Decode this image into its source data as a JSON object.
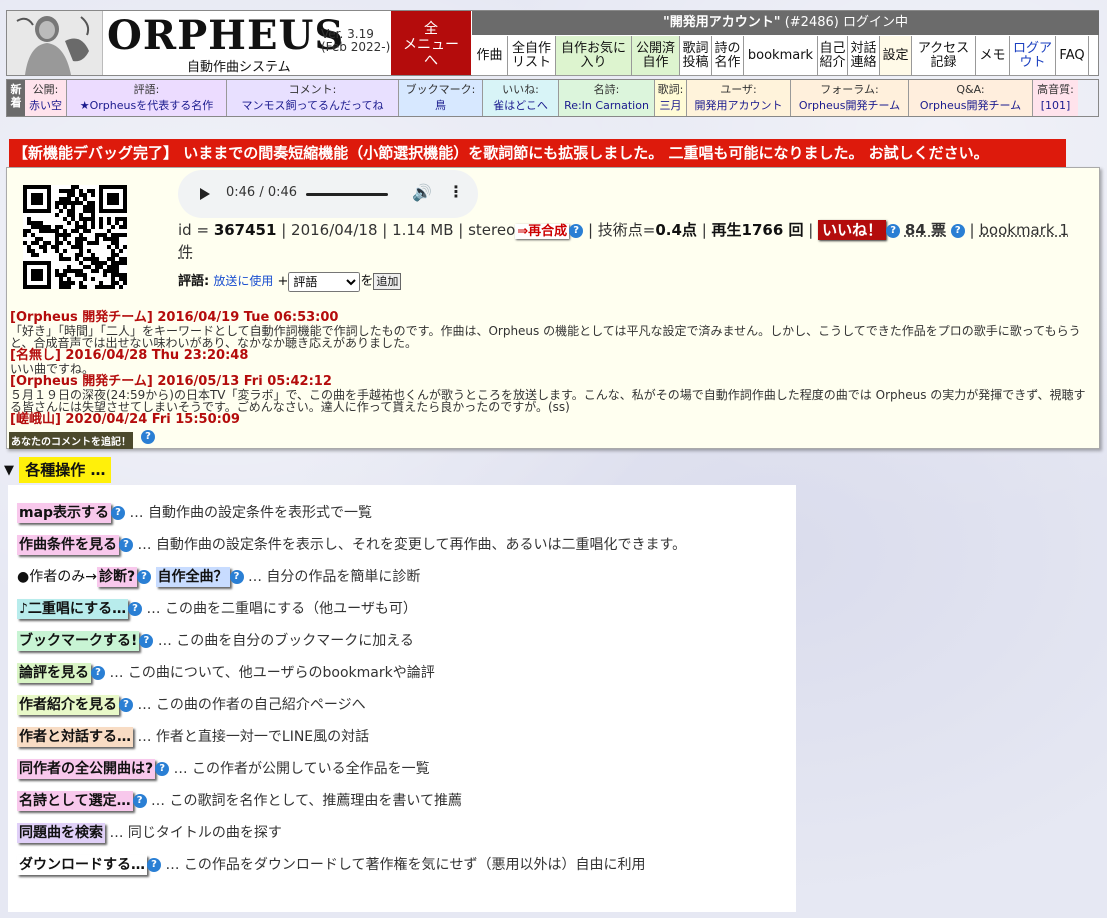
{
  "header": {
    "logo_title": "ORPHEUS",
    "logo_subtitle": "自動作曲システム",
    "version_line1": "Ver. 3.19",
    "version_line2": "(Feb 2022-)",
    "all_menu_line1": "全",
    "all_menu_line2": "メニュー",
    "all_menu_line3": "へ",
    "account_name": "\"開発用アカウント\"",
    "account_id": "(#2486)",
    "login_status": "ログイン中"
  },
  "nav": [
    {
      "label": "作曲",
      "color": "#fff"
    },
    {
      "label": "全自作リスト",
      "color": "#fff"
    },
    {
      "label": "自作お気に入り",
      "color": "#ddf4cf"
    },
    {
      "label": "公開済自作",
      "color": "#ddf4cf"
    },
    {
      "label": "歌詞投稿",
      "color": "#fff"
    },
    {
      "label": "詩の名作",
      "color": "#fff"
    },
    {
      "label": "bookmark",
      "color": "#fff"
    },
    {
      "label": "自己紹介",
      "color": "#fff"
    },
    {
      "label": "対話連絡",
      "color": "#fff"
    },
    {
      "label": "設定",
      "color": "#fffae8"
    },
    {
      "label": "アクセス記録",
      "color": "#fff"
    },
    {
      "label": "メモ",
      "color": "#fff"
    },
    {
      "label": "ログアウト",
      "color": "#fff"
    },
    {
      "label": "FAQ",
      "color": "#fff"
    }
  ],
  "subbar": {
    "new_label": "新着",
    "items": [
      {
        "label": "公開:",
        "value": "赤い空",
        "color": "#ffe3ec"
      },
      {
        "label": "評語:",
        "value": "★Orpheusを代表する名作",
        "color": "#ecdcff"
      },
      {
        "label": "コメント:",
        "value": "マンモス飼ってるんだってね",
        "color": "#e8e0ff"
      },
      {
        "label": "ブックマーク:",
        "value": "鳥",
        "color": "#d7e8ff"
      },
      {
        "label": "いいね:",
        "value": "雀はどこへ",
        "color": "#d8f4f7"
      },
      {
        "label": "名詩:",
        "value": "Re:In Carnation",
        "color": "#dcf5dc"
      },
      {
        "label": "歌詞:",
        "value": "三月",
        "color": "#fffbd6"
      },
      {
        "label": "ユーザ:",
        "value": "開発用アカウント",
        "color": "#fff3db"
      },
      {
        "label": "フォーラム:",
        "value": "Orpheus開発チーム",
        "color": "#fff0dc"
      },
      {
        "label": "Q&A:",
        "value": "Orpheus開発チーム",
        "color": "#ffeedd"
      },
      {
        "label": "高音質:",
        "value": "[101]",
        "color": "#ffe3ec"
      }
    ]
  },
  "announcement": "【新機能デバッグ完了】 いままでの間奏短縮機能（小節選択機能）を歌詞節にも拡張しました。 二重唱も可能になりました。 お試しください。",
  "player": {
    "time": "0:46 / 0:46"
  },
  "song": {
    "id_label": "id =",
    "id": "367451",
    "date": "2016/04/18",
    "size": "1.14 MB",
    "channel": "stereo",
    "resynth_label": "⇒再合成",
    "tech_label": "技術点=",
    "tech_value": "0.4点",
    "plays": "再生1766 回",
    "like_label": "いいね！",
    "votes": "84 票",
    "bookmark_text": "bookmark 1 件"
  },
  "review": {
    "label": "評語:",
    "broadcast_link": "放送に使用",
    "plus": "+",
    "select_value": "評語",
    "wo": "を",
    "add_button": "追加"
  },
  "comments": [
    {
      "head": "[Orpheus 開発チーム] 2016/04/19 Tue 06:53:00",
      "body": "「好き」「時間」「二人」をキーワードとして自動作詞機能で作詞したものです。作曲は、Orpheus の機能としては平凡な設定で済みません。しかし、こうしてできた作品をプロの歌手に歌ってもらうと、合成音声では出せない味わいがあり、なかなか聴き応えがありました。"
    },
    {
      "head": "[名無し] 2016/04/28 Thu 23:20:48",
      "body": "いい曲ですね。"
    },
    {
      "head": "[Orpheus 開発チーム] 2016/05/13 Fri 05:42:12",
      "body": "５月１９日の深夜(24:59から)の日本TV「変ラボ」で、この曲を手越祐也くんが歌うところを放送します。こんな、私がその場で自動作詞作曲した程度の曲では Orpheus の実力が発揮できず、視聴する皆さんには失望させてしまいそうです。ごめんなさい。達人に作って貰えたら良かったのですが。(ss)"
    },
    {
      "head": "[嵯峨山] 2020/04/24 Fri 15:50:09",
      "body": ""
    }
  ],
  "add_comment": "あなたのコメントを追記！",
  "ops_title": "各種操作 …",
  "ops": [
    {
      "btn": "map表示する",
      "color": "#f8c8ec",
      "desc": "… 自動作曲の設定条件を表形式で一覧"
    },
    {
      "btn": "作曲条件を見る",
      "color": "#f8c8ec",
      "desc": "… 自動作曲の設定条件を表示し、それを変更して再作曲、あるいは二重唱化できます。"
    },
    {
      "prefix": "●作者のみ→",
      "btn": "診断?",
      "color": "#f8c8ec",
      "btn2": "自作全曲？",
      "color2": "#c8dcff",
      "desc": "… 自分の作品を簡単に診断"
    },
    {
      "btn": "♪二重唱にする…",
      "color": "#b8ecec",
      "desc": "… この曲を二重唱にする（他ユーザも可）"
    },
    {
      "btn": "ブックマークする!",
      "color": "#c8f4d4",
      "desc": "… この曲を自分のブックマークに加える"
    },
    {
      "btn": "論評を見る",
      "color": "#d8f4c4",
      "desc": "… この曲について、他ユーザらのbookmarkや論評"
    },
    {
      "btn": "作者紹介を見る",
      "color": "#e8f8c8",
      "desc": "… この曲の作者の自己紹介ページへ"
    },
    {
      "btn": "作者と対話する…",
      "color": "#f8dcc4",
      "desc": "… 作者と直接一対一でLINE風の対話"
    },
    {
      "btn": "同作者の全公開曲は?",
      "color": "#f8c8ec",
      "desc": "… この作者が公開している全作品を一覧"
    },
    {
      "btn": "名詩として選定…",
      "color": "#f8c8ec",
      "desc": "… この歌詞を名作として、推薦理由を書いて推薦"
    },
    {
      "btn": "同題曲を検索",
      "color": "#e0d0f8",
      "desc": "… 同じタイトルの曲を探す"
    },
    {
      "btn": "ダウンロードする…",
      "color": "#ffffff",
      "desc": "… この作品をダウンロードして著作権を気にせず（悪用以外は）自由に利用"
    }
  ]
}
